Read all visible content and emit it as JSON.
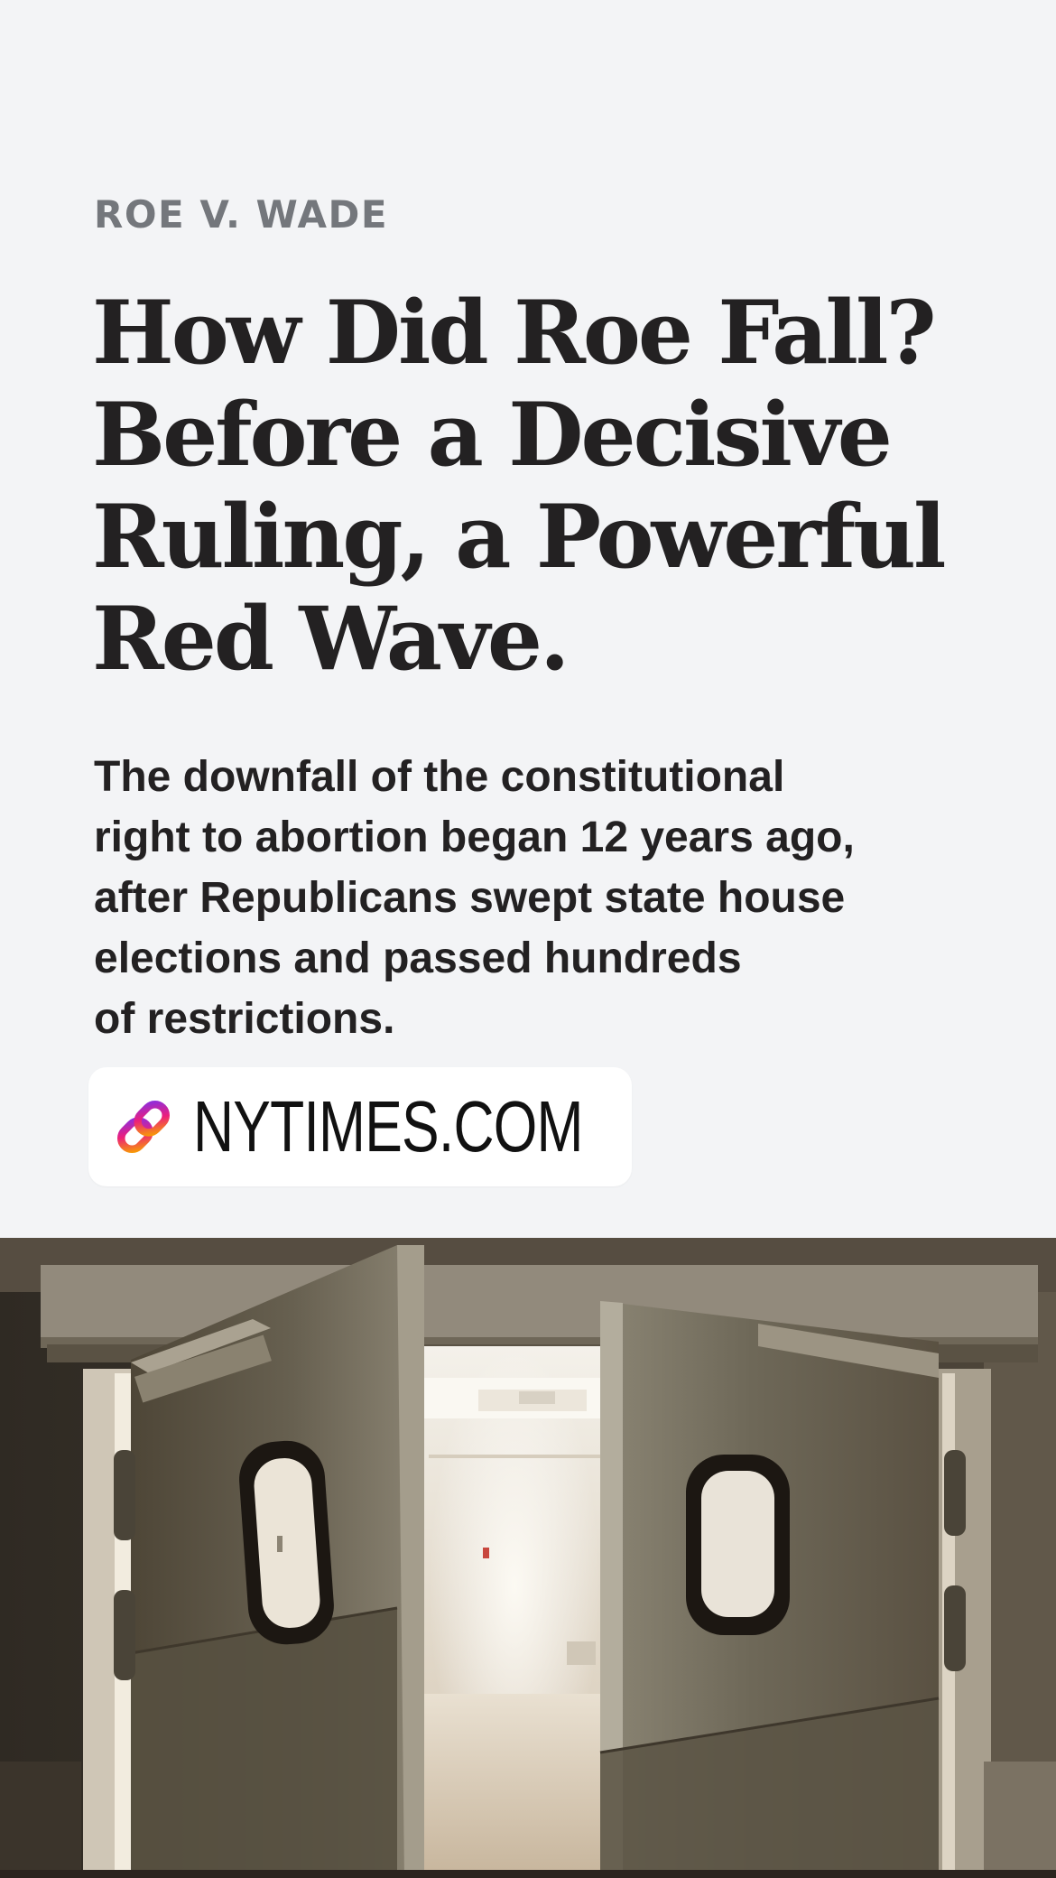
{
  "story": {
    "kicker": "ROE V. WADE",
    "headline_lines": [
      "How Did Roe Fall?",
      "Before a Decisive",
      "Ruling, a Powerful",
      "Red Wave."
    ],
    "summary_lines": [
      "The downfall of the constitutional",
      "right to abortion began 12 years ago,",
      "after Republicans swept state house",
      "elections and passed hundreds",
      "of restrictions."
    ]
  },
  "link_sticker": {
    "icon": "link-icon",
    "label": "NYTIMES.COM"
  },
  "colors": {
    "background": "#f3f4f6",
    "kicker": "#74777c",
    "text": "#232122",
    "sticker_background": "#ffffff",
    "link_gradient_start": "#f8a000",
    "link_gradient_mid": "#ec1f7b",
    "link_gradient_end": "#8b2fe0"
  }
}
